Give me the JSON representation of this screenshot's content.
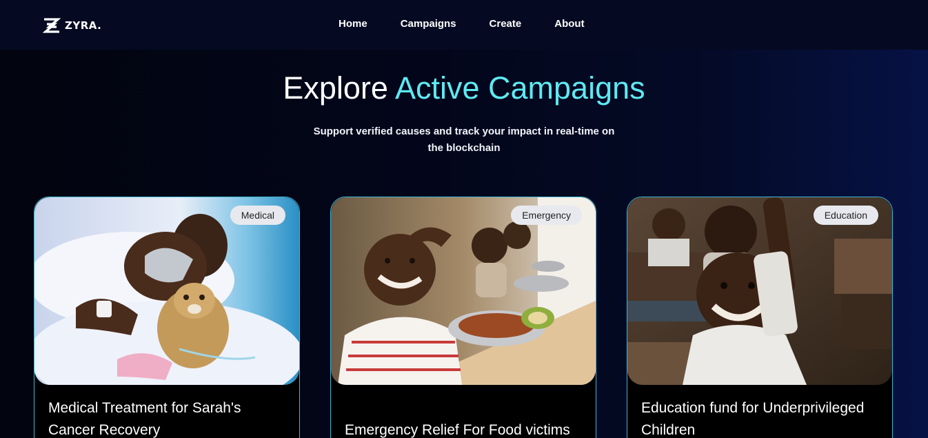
{
  "brand": {
    "name": "ZYRA."
  },
  "nav": {
    "items": [
      {
        "label": "Home"
      },
      {
        "label": "Campaigns"
      },
      {
        "label": "Create"
      },
      {
        "label": "About"
      }
    ]
  },
  "hero": {
    "title_plain": "Explore ",
    "title_accent": "Active Campaigns",
    "subtitle": "Support verified causes and track your impact in real-time on the blockchain"
  },
  "campaigns": [
    {
      "category": "Medical",
      "title": "Medical Treatment for Sarah's Cancer Recovery"
    },
    {
      "category": "Emergency",
      "title": "Emergency Relief For Food victims"
    },
    {
      "category": "Education",
      "title": "Education fund for Underprivileged Children"
    }
  ],
  "colors": {
    "accent": "#5ee9f2",
    "background": "#03061a",
    "navbar": "#050a22",
    "card_border": "#3fb7d6",
    "tag_background": "#e7e9ee"
  }
}
